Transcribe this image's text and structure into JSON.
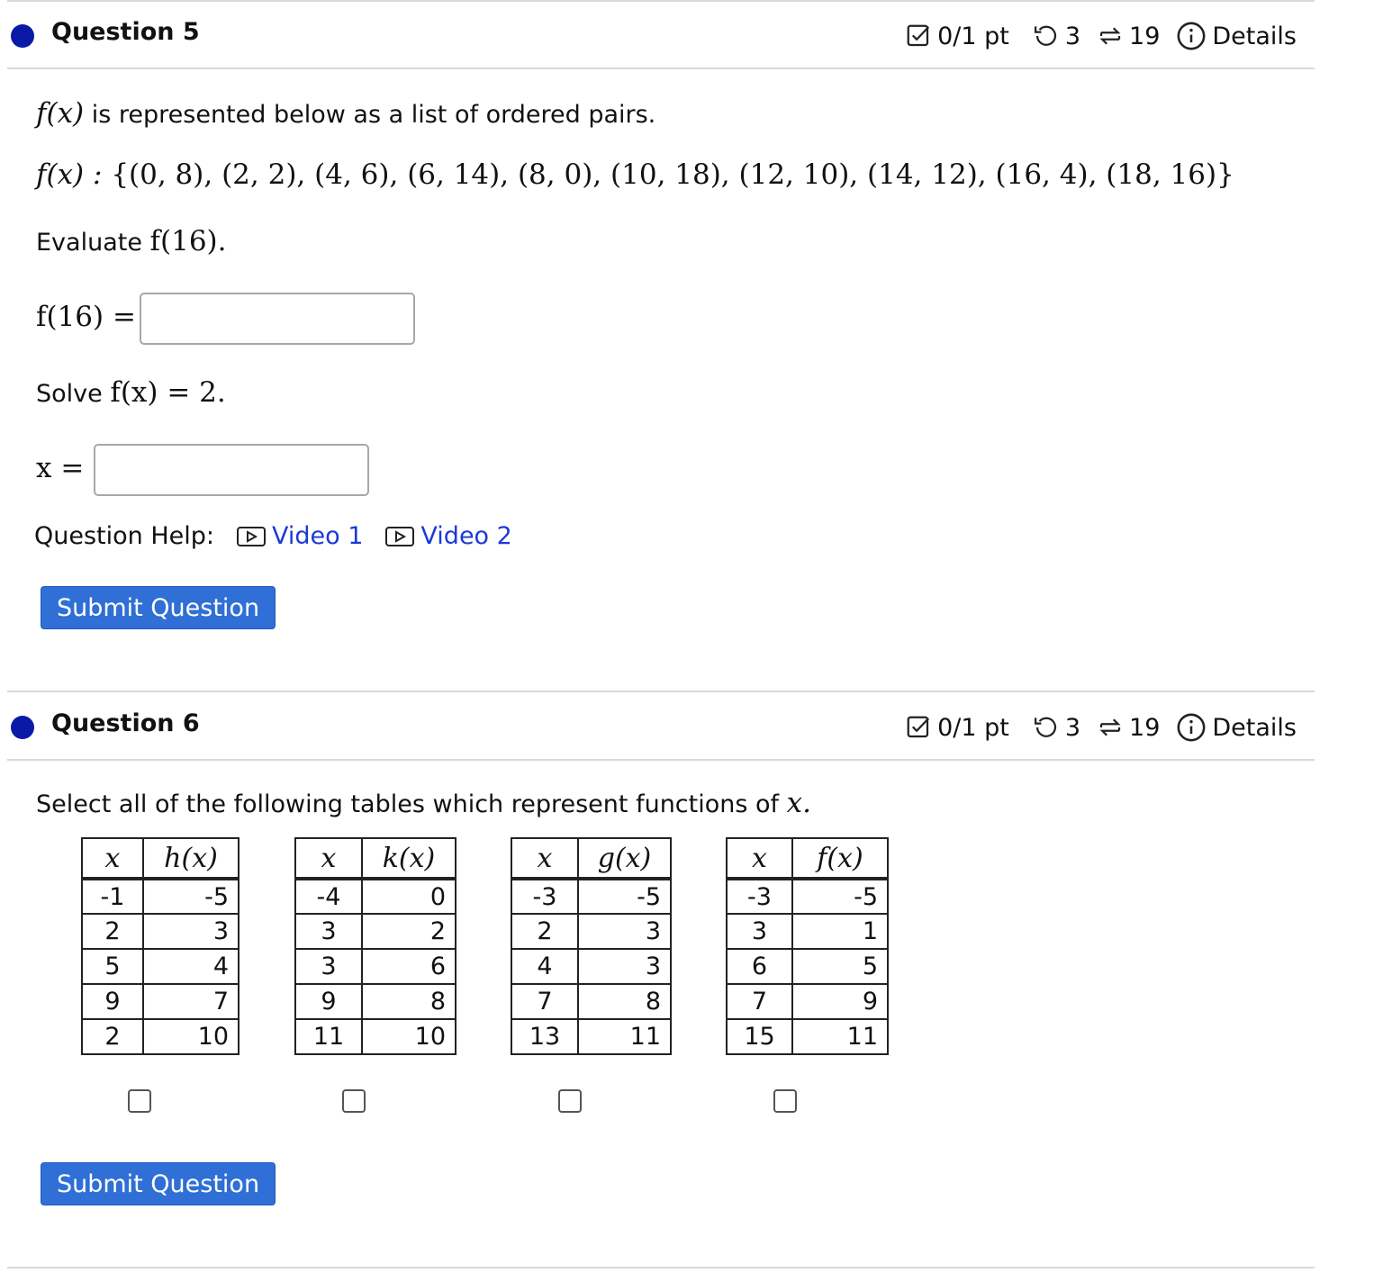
{
  "q5": {
    "title": "Question 5",
    "meta": {
      "points": "0/1 pt",
      "retries": "3",
      "attempts": "19",
      "details": "Details"
    },
    "intro_fx": "f(x)",
    "intro_text": " is represented below as a list of ordered pairs.",
    "pairs_label": "f(x) : ",
    "pairs_set": "{(0, 8), (2, 2), (4, 6), (6, 14), (8, 0), (10, 18), (12, 10), (14, 12), (16, 4), (18, 16)}",
    "evaluate_text": "Evaluate ",
    "evaluate_math": "f(16).",
    "input1_label": "f(16) =",
    "input1_value": "",
    "solve_text": "Solve ",
    "solve_math": "f(x) = 2.",
    "input2_label": "x =",
    "input2_value": "",
    "help_label": "Question Help:",
    "video1": "Video 1",
    "video2": "Video 2",
    "submit": "Submit Question"
  },
  "q6": {
    "title": "Question 6",
    "meta": {
      "points": "0/1 pt",
      "retries": "3",
      "attempts": "19",
      "details": "Details"
    },
    "prompt_text": "Select all of the following tables which represent functions of ",
    "prompt_math": "x.",
    "tables": [
      {
        "xh": "x",
        "yh": "h(x)",
        "rows": [
          [
            "-1",
            "-5"
          ],
          [
            "2",
            "3"
          ],
          [
            "5",
            "4"
          ],
          [
            "9",
            "7"
          ],
          [
            "2",
            "10"
          ]
        ]
      },
      {
        "xh": "x",
        "yh": "k(x)",
        "rows": [
          [
            "-4",
            "0"
          ],
          [
            "3",
            "2"
          ],
          [
            "3",
            "6"
          ],
          [
            "9",
            "8"
          ],
          [
            "11",
            "10"
          ]
        ]
      },
      {
        "xh": "x",
        "yh": "g(x)",
        "rows": [
          [
            "-3",
            "-5"
          ],
          [
            "2",
            "3"
          ],
          [
            "4",
            "3"
          ],
          [
            "7",
            "8"
          ],
          [
            "13",
            "11"
          ]
        ]
      },
      {
        "xh": "x",
        "yh": "f(x)",
        "rows": [
          [
            "-3",
            "-5"
          ],
          [
            "3",
            "1"
          ],
          [
            "6",
            "5"
          ],
          [
            "7",
            "9"
          ],
          [
            "15",
            "11"
          ]
        ]
      }
    ],
    "submit": "Submit Question"
  },
  "colors": {
    "accent": "#2f6fd6",
    "link": "#1c39d9",
    "dot": "#0b1aa6",
    "rule": "#d8d8d8"
  },
  "icons": [
    "checkbox-score-icon",
    "retry-icon",
    "attempts-icon",
    "info-icon",
    "video-icon"
  ]
}
